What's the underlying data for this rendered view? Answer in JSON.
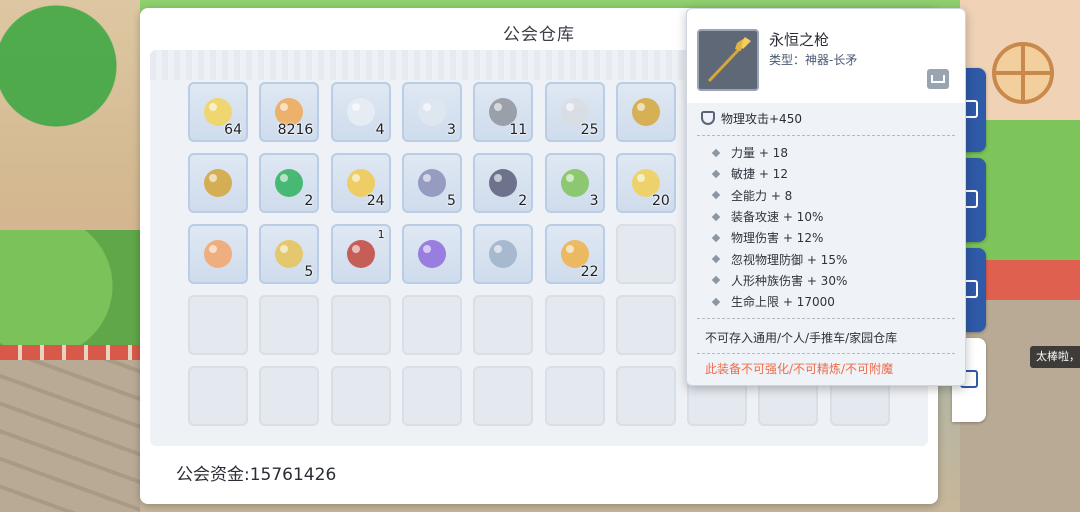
{
  "panel": {
    "title": "公会仓库",
    "funds_text": "公会资金:15761426"
  },
  "items": [
    {
      "icon": "lightning-shard-icon",
      "qty": "64"
    },
    {
      "icon": "amber-crystal-icon",
      "qty": "8216"
    },
    {
      "icon": "snowflake-icon",
      "qty": "4"
    },
    {
      "icon": "light-dust-icon",
      "qty": "3"
    },
    {
      "icon": "stone-fragment-icon",
      "qty": "11"
    },
    {
      "icon": "pearl-pendant-icon",
      "qty": "25"
    },
    {
      "icon": "golden-spear-icon",
      "qty": ""
    },
    {
      "icon": "golden-staff-icon",
      "qty": ""
    },
    {
      "icon": "green-gem-icon",
      "qty": "2"
    },
    {
      "icon": "golden-wing-icon",
      "qty": "24"
    },
    {
      "icon": "steel-gauntlet-icon",
      "qty": "5"
    },
    {
      "icon": "dark-bracer-icon",
      "qty": "2"
    },
    {
      "icon": "green-emblem-icon",
      "qty": "3"
    },
    {
      "icon": "thunder-rune-icon",
      "qty": "20"
    },
    {
      "icon": "orange-orb-icon",
      "qty": ""
    },
    {
      "icon": "golden-cross-icon",
      "qty": "5"
    },
    {
      "icon": "winged-card-icon",
      "qty": "1"
    },
    {
      "icon": "violet-crystal-icon",
      "qty": ""
    },
    {
      "icon": "silver-ring-icon",
      "qty": ""
    },
    {
      "icon": "fire-flame-icon",
      "qty": "22"
    }
  ],
  "tooltip": {
    "name": "永恒之枪",
    "type": "类型：神器-长矛",
    "main_stat": "物理攻击+450",
    "stats": [
      "力量 + 18",
      "敏捷 + 12",
      "全能力 + 8",
      "装备攻速 + 10%",
      "物理伤害 + 12%",
      "忽视物理防御 + 15%",
      "人形种族伤害 + 30%",
      "生命上限 + 17000"
    ],
    "storage_note": "不可存入通用/个人/手推车/家园仓库",
    "warning": "此装备不可强化/不可精炼/不可附魔"
  },
  "toast": "太棒啦，",
  "colors": {
    "accent_blue": "#2f5aa8",
    "warning_orange": "#ef6b4a",
    "slot_border": "#b9cde6"
  }
}
